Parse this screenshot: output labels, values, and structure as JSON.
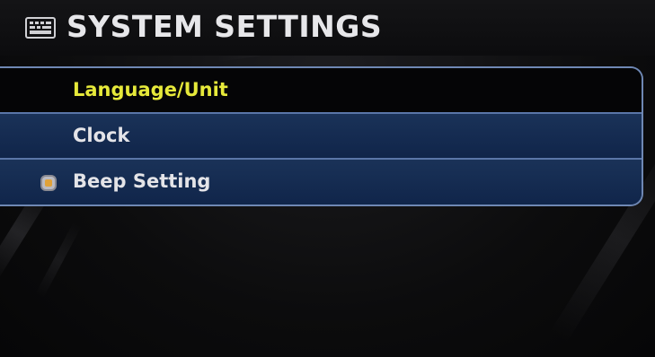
{
  "header": {
    "title": "SYSTEM SETTINGS",
    "icon": "keyboard-icon"
  },
  "menu": {
    "items": [
      {
        "label": "Language/Unit",
        "selected": true,
        "has_indicator": false
      },
      {
        "label": "Clock",
        "selected": false,
        "has_indicator": false
      },
      {
        "label": "Beep Setting",
        "selected": false,
        "has_indicator": true,
        "indicator_color": "#e0a23a"
      }
    ]
  },
  "colors": {
    "selected_text": "#e6e93a",
    "item_text": "#e4e4e8",
    "item_background": "#122745",
    "border": "#6f88b4"
  }
}
